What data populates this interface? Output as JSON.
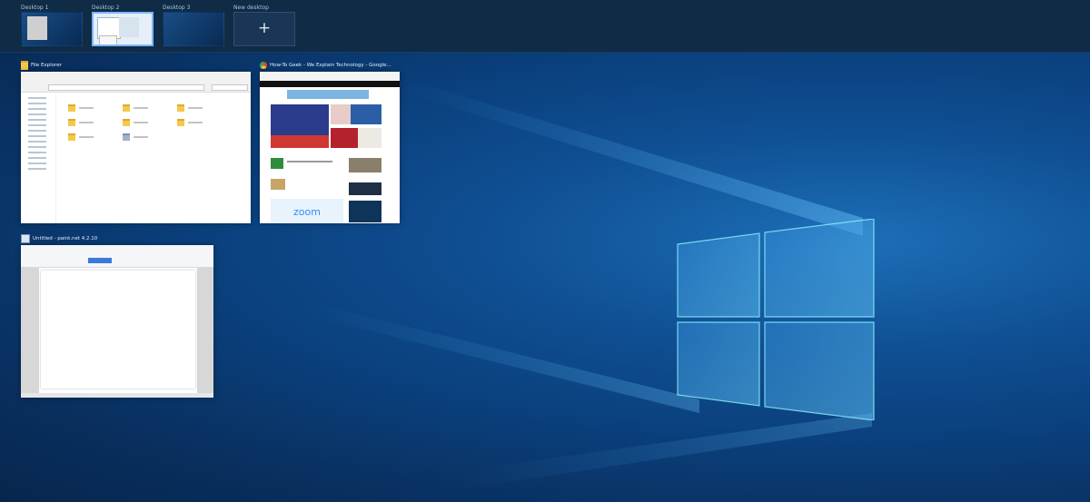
{
  "desktops": [
    {
      "label": "Desktop 1"
    },
    {
      "label": "Desktop 2",
      "active": true
    },
    {
      "label": "Desktop 3"
    },
    {
      "label": "New desktop",
      "icon": "plus-icon"
    }
  ],
  "windows": {
    "explorer": {
      "title": "File Explorer",
      "icon": "folder-icon"
    },
    "browser": {
      "title": "How-To Geek - We Explain Technology - Google...",
      "icon": "chrome-icon"
    },
    "wordpad": {
      "title": "Untitled - paint.net 4.2.10",
      "icon": "document-icon"
    }
  },
  "browser_content": {
    "ad_text": "zoom"
  },
  "colors": {
    "accent": "#7ab8ff",
    "folder": "#f2c94c",
    "logo_glow": "#7ee8ff"
  }
}
